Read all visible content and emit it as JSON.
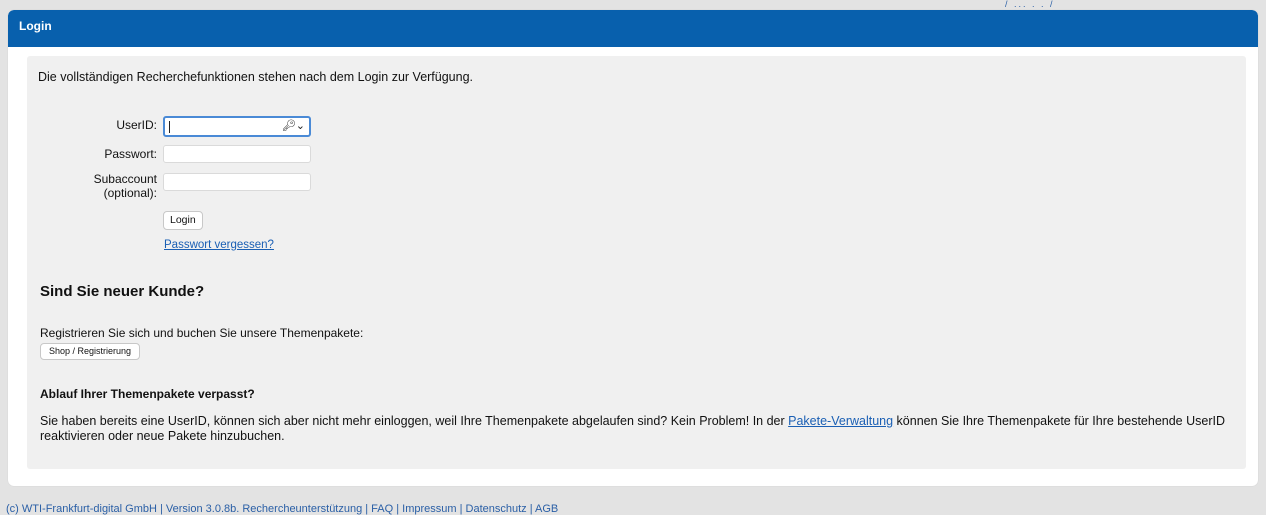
{
  "panel": {
    "title": "Login"
  },
  "intro": "Die vollständigen Recherchefunktionen stehen nach dem Login zur Verfügung.",
  "form": {
    "userid_label": "UserID:",
    "userid_value": "",
    "password_label": "Passwort:",
    "password_value": "",
    "subaccount_label_line1": "Subaccount",
    "subaccount_label_line2": "(optional):",
    "subaccount_value": "",
    "login_button": "Login",
    "forgot_link": "Passwort vergessen?"
  },
  "new_customer": {
    "heading": "Sind Sie neuer Kunde?",
    "text": "Registrieren Sie sich und buchen Sie unsere Themenpakete:",
    "button": "Shop / Registrierung"
  },
  "expired": {
    "heading": "Ablauf Ihrer Themenpakete verpasst?",
    "text_before": "Sie haben bereits eine UserID, können sich aber nicht mehr einloggen, weil Ihre Themenpakete abgelaufen sind? Kein Problem! In der ",
    "link": "Pakete-Verwaltung",
    "text_after": " können Sie Ihre Themenpakete für Ihre bestehende UserID reaktivieren oder neue Pakete hinzubuchen."
  },
  "footer": "(c) WTI-Frankfurt-digital GmbH | Version 3.0.8b. Rechercheunterstützung | FAQ | Impressum | Datenschutz | AGB",
  "top_fragment": "/ ... . . /",
  "colors": {
    "header_bg": "#0860ad",
    "link": "#1a5fb4",
    "body_bg": "#f0f0f0"
  }
}
